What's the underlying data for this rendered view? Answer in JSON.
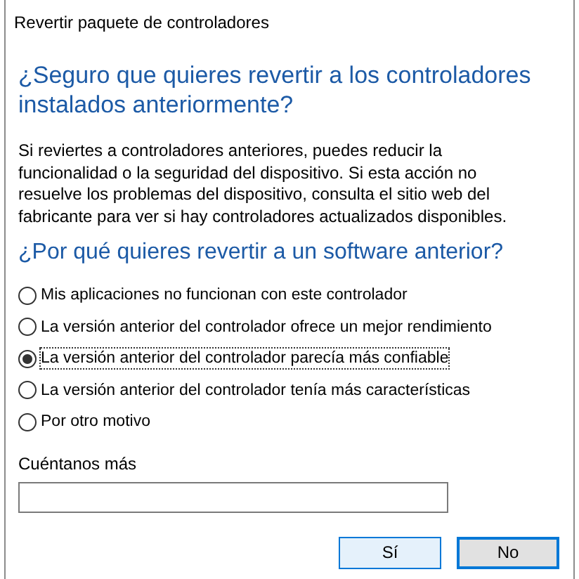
{
  "window": {
    "title": "Revertir paquete de controladores"
  },
  "heading": "¿Seguro que quieres revertir a los controladores instalados anteriormente?",
  "description": "Si reviertes a controladores anteriores, puedes reducir la funcionalidad o la seguridad del dispositivo. Si esta acción no resuelve los problemas del dispositivo, consulta el sitio web del fabricante para ver si hay controladores actualizados disponibles.",
  "question": "¿Por qué quieres revertir a un software anterior?",
  "options": [
    {
      "label": "Mis aplicaciones no funcionan con este controlador",
      "selected": false
    },
    {
      "label": "La versión anterior del controlador ofrece un mejor rendimiento",
      "selected": false
    },
    {
      "label": "La versión anterior del controlador parecía más confiable",
      "selected": true
    },
    {
      "label": "La versión anterior del controlador tenía más características",
      "selected": false
    },
    {
      "label": "Por otro motivo",
      "selected": false
    }
  ],
  "more": {
    "label": "Cuéntanos más"
  },
  "buttons": [
    {
      "label": "Sí",
      "kind": "hover"
    },
    {
      "label": "No",
      "kind": "default"
    }
  ]
}
